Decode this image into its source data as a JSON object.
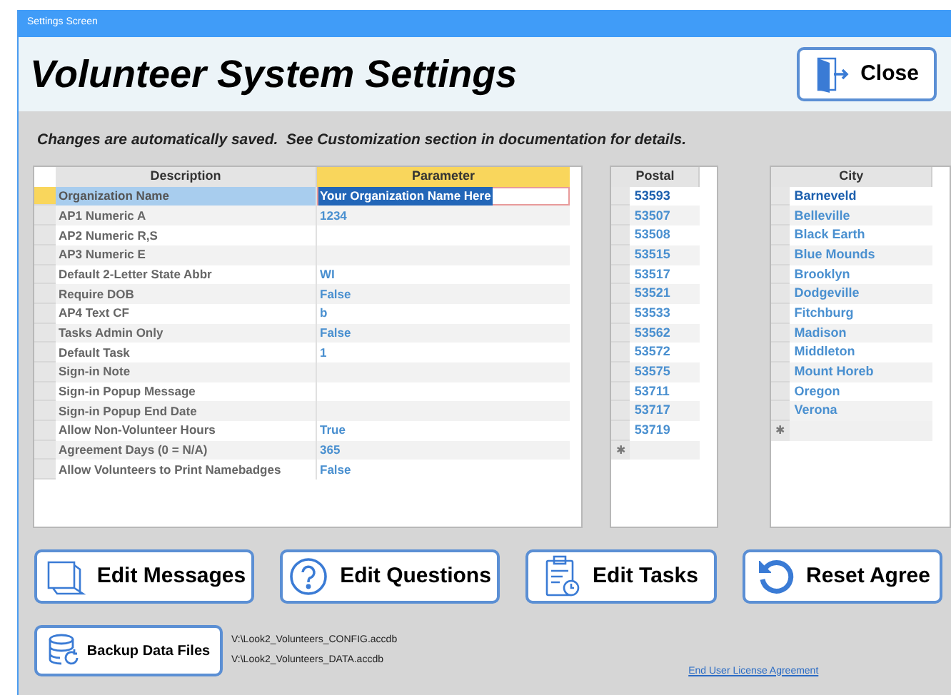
{
  "window": {
    "title": "Settings Screen"
  },
  "header": {
    "title": "Volunteer System Settings",
    "close_button": "Close"
  },
  "notice": "Changes are automatically saved.  See Customization section in documentation for details.",
  "settings_table": {
    "columns": [
      "Description",
      "Parameter"
    ],
    "rows": [
      {
        "description": "Organization Name",
        "value": "Your Organization Name Here",
        "selected": true
      },
      {
        "description": "AP1 Numeric A",
        "value": "1234",
        "selected": false
      },
      {
        "description": "AP2 Numeric R,S",
        "selected": false
      },
      {
        "description": "AP3 Numeric E",
        "selected": false
      },
      {
        "description": "Default 2-Letter State Abbr",
        "value": "WI",
        "selected": false
      },
      {
        "description": "Require DOB",
        "value": "False",
        "selected": false
      },
      {
        "description": "AP4 Text CF",
        "value": "b",
        "selected": false
      },
      {
        "description": "Tasks Admin Only",
        "value": "False",
        "selected": false
      },
      {
        "description": "Default Task",
        "value": "1",
        "selected": false
      },
      {
        "description": "Sign-in Note",
        "selected": false
      },
      {
        "description": "Sign-in Popup Message",
        "selected": false
      },
      {
        "description": "Sign-in Popup End Date",
        "selected": false
      },
      {
        "description": "Allow Non-Volunteer Hours",
        "value": "True",
        "selected": false
      },
      {
        "description": "Agreement Days (0 = N/A)",
        "value": "365",
        "selected": false
      },
      {
        "description": "Allow Volunteers to Print Namebadges",
        "value": "False",
        "selected": false
      }
    ]
  },
  "postal_table": {
    "column": "Postal",
    "new_row_marker": "✱",
    "rows": [
      {
        "value": "53593",
        "selected": true
      },
      {
        "value": "53507",
        "selected": false
      },
      {
        "value": "53508",
        "selected": false
      },
      {
        "value": "53515",
        "selected": false
      },
      {
        "value": "53517",
        "selected": false
      },
      {
        "value": "53521",
        "selected": false
      },
      {
        "value": "53533",
        "selected": false
      },
      {
        "value": "53562",
        "selected": false
      },
      {
        "value": "53572",
        "selected": false
      },
      {
        "value": "53575",
        "selected": false
      },
      {
        "value": "53711",
        "selected": false
      },
      {
        "value": "53717",
        "selected": false
      },
      {
        "value": "53719",
        "selected": false
      }
    ]
  },
  "city_table": {
    "column": "City",
    "new_row_marker": "✱",
    "rows": [
      {
        "value": "Barneveld",
        "selected": true
      },
      {
        "value": "Belleville",
        "selected": false
      },
      {
        "value": "Black Earth",
        "selected": false
      },
      {
        "value": "Blue Mounds",
        "selected": false
      },
      {
        "value": "Brooklyn",
        "selected": false
      },
      {
        "value": "Dodgeville",
        "selected": false
      },
      {
        "value": "Fitchburg",
        "selected": false
      },
      {
        "value": "Madison",
        "selected": false
      },
      {
        "value": "Middleton",
        "selected": false
      },
      {
        "value": "Mount Horeb",
        "selected": false
      },
      {
        "value": "Oregon",
        "selected": false
      },
      {
        "value": "Verona",
        "selected": false
      }
    ]
  },
  "buttons": [
    {
      "kind": "messages",
      "label": "Edit Messages"
    },
    {
      "kind": "questions",
      "label": "Edit Questions"
    },
    {
      "kind": "tasks",
      "label": "Edit Tasks"
    },
    {
      "kind": "reset",
      "label": "Reset Agree"
    }
  ],
  "backup": {
    "label": "Backup Data Files",
    "paths": [
      "V:\\Look2_Volunteers_CONFIG.accdb",
      "V:\\Look2_Volunteers_DATA.accdb"
    ]
  },
  "license_link": "End User License Agreement"
}
